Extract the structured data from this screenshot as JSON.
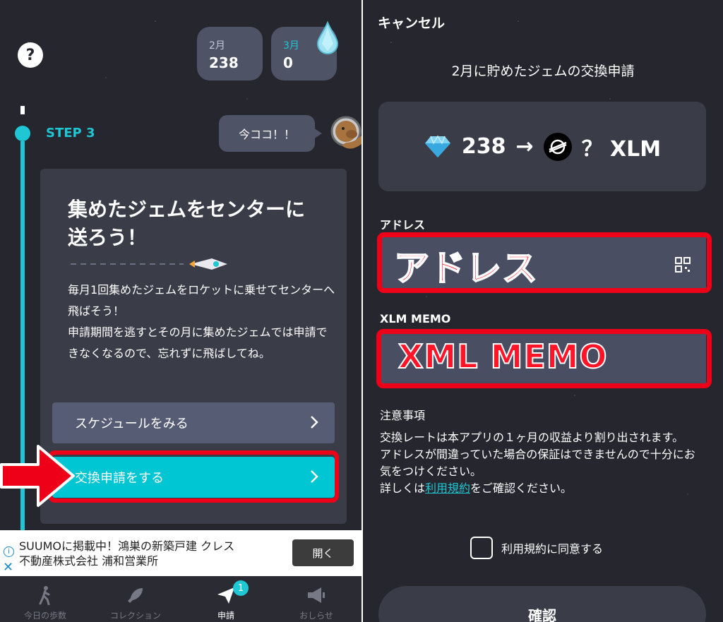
{
  "left": {
    "months": [
      {
        "label": "2月",
        "value": "238"
      },
      {
        "label": "3月",
        "value": "0"
      }
    ],
    "step": "STEP 3",
    "bubble": "今ココ！！",
    "card": {
      "title": "集めたジェムをセンターに送ろう！",
      "body": "毎月1回集めたジェムをロケットに乗せてセンターへ飛ばそう！\n申請期間を逃すとその月に集めたジェムでは申請できなくなるので、忘れずに飛ばしてね。",
      "schedule_label": "スケジュールをみる",
      "apply_label": "交換申請をする"
    },
    "ad": {
      "text_line1": "SUUMOに掲載中！鴻巣の新築戸建 クレス",
      "text_line2": "不動産株式会社 浦和営業所",
      "button": "開く"
    },
    "tabs": [
      {
        "label": "今日の歩数",
        "icon": "walk-icon"
      },
      {
        "label": "コレクション",
        "icon": "rocket-icon"
      },
      {
        "label": "申請",
        "icon": "paper-plane-icon",
        "badge": "1"
      },
      {
        "label": "おしらせ",
        "icon": "megaphone-icon"
      }
    ]
  },
  "right": {
    "cancel": "キャンセル",
    "title": "2月に貯めたジェムの交換申請",
    "exchange": {
      "gems": "238",
      "arrow": "→",
      "xlm": "？ XLM"
    },
    "address_label": "アドレス",
    "address_overlay": "アドレス",
    "memo_label": "XLM MEMO",
    "memo_overlay": "XML MEMO",
    "notes_title": "注意事項",
    "notes_line1": "交換レートは本アプリの１ヶ月の収益より割り出されます。",
    "notes_line2": "アドレスが間違っていた場合の保証はできませんので十分にお気をつけください。",
    "notes_line3_prefix": "詳しくは",
    "notes_link": "利用規約",
    "notes_line3_suffix": "をご確認ください。",
    "agree_label": "利用規約に同意する",
    "confirm": "確認"
  },
  "colors": {
    "accent": "#1fc6d4",
    "highlight": "#ee0018"
  }
}
